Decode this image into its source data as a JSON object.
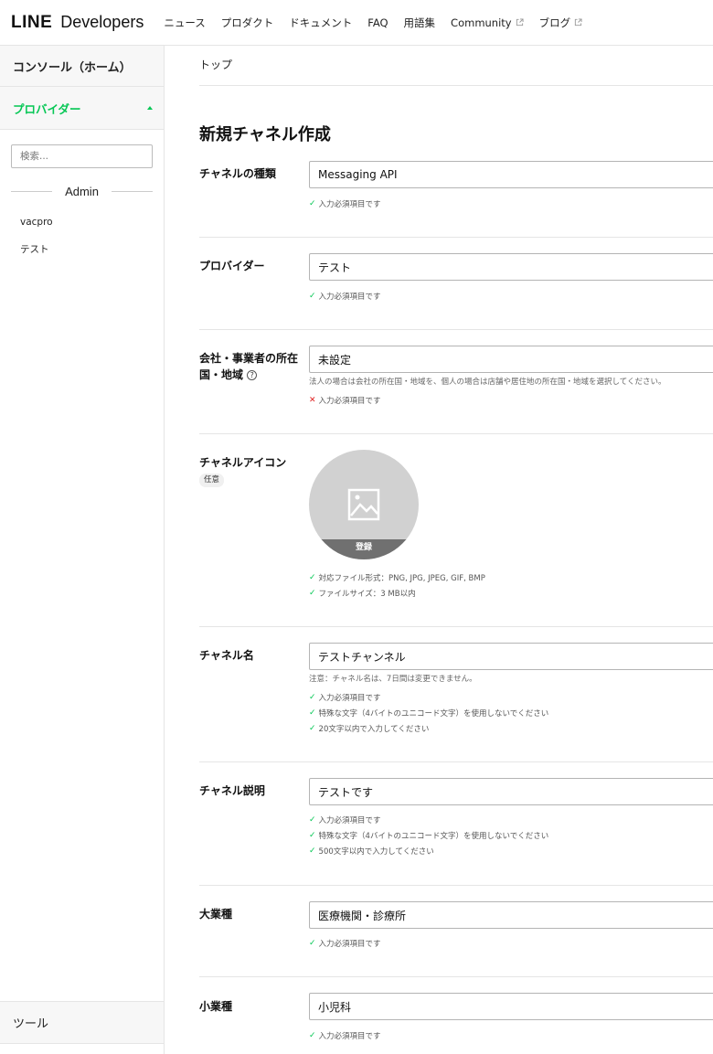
{
  "header": {
    "logo_line": "LINE",
    "logo_dev": "Developers",
    "nav": [
      "ニュース",
      "プロダクト",
      "ドキュメント",
      "FAQ",
      "用語集",
      "Community",
      "ブログ"
    ]
  },
  "sidebar": {
    "console": "コンソール（ホーム）",
    "provider": "プロバイダー",
    "search_placeholder": "検索...",
    "group_label": "Admin",
    "items": [
      "vacpro",
      "テスト"
    ],
    "tool": "ツール"
  },
  "main": {
    "breadcrumb": "トップ",
    "title": "新規チャネル作成",
    "channel_type": {
      "label": "チャネルの種類",
      "value": "Messaging API",
      "check1": "入力必須項目です"
    },
    "provider": {
      "label": "プロバイダー",
      "value": "テスト",
      "check1": "入力必須項目です"
    },
    "country": {
      "label_line1": "会社・事業者の所在",
      "label_line2": "国・地域",
      "help": "?",
      "value": "未設定",
      "note": "法人の場合は会社の所在国・地域を、個人の場合は店舗や居住地の所在国・地域を選択してください。",
      "error": "入力必須項目です"
    },
    "icon": {
      "label": "チャネルアイコン",
      "optional": "任意",
      "button": "登録",
      "check1": "対応ファイル形式：PNG, JPG, JPEG, GIF, BMP",
      "check2": "ファイルサイズ：3 MB以内"
    },
    "name": {
      "label": "チャネル名",
      "value": "テストチャンネル",
      "note": "注意：チャネル名は、7日間は変更できません。",
      "check1": "入力必須項目です",
      "check2": "特殊な文字（4バイトのユニコード文字）を使用しないでください",
      "check3": "20文字以内で入力してください"
    },
    "description": {
      "label": "チャネル説明",
      "value": "テストです",
      "check1": "入力必須項目です",
      "check2": "特殊な文字（4バイトのユニコード文字）を使用しないでください",
      "check3": "500文字以内で入力してください"
    },
    "major": {
      "label": "大業種",
      "value": "医療機関・診療所",
      "check1": "入力必須項目です"
    },
    "minor": {
      "label": "小業種",
      "value": "小児科",
      "check1": "入力必須項目です"
    }
  },
  "colors": {
    "accent": "#06c755",
    "error": "#e02020"
  },
  "icons": {
    "check": "checkmark-icon",
    "error": "x-icon",
    "external": "external-link-icon",
    "image": "image-placeholder-icon"
  }
}
